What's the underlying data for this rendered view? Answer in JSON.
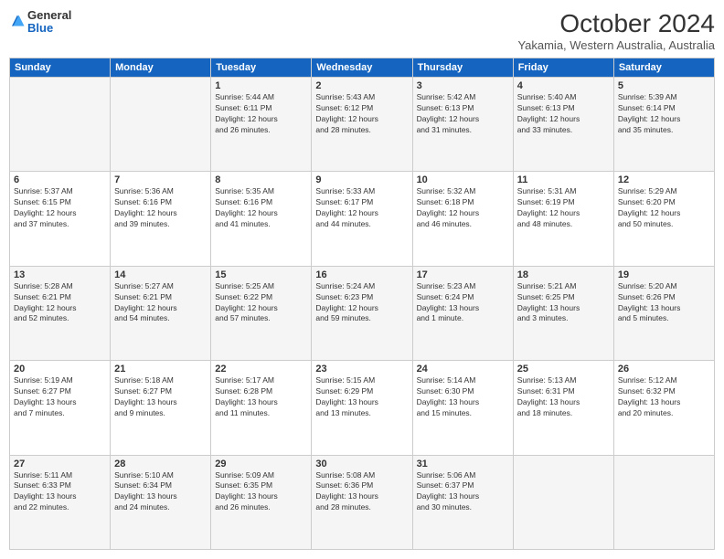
{
  "logo": {
    "general": "General",
    "blue": "Blue"
  },
  "title": "October 2024",
  "location": "Yakamia, Western Australia, Australia",
  "headers": [
    "Sunday",
    "Monday",
    "Tuesday",
    "Wednesday",
    "Thursday",
    "Friday",
    "Saturday"
  ],
  "weeks": [
    [
      {
        "day": "",
        "info": ""
      },
      {
        "day": "",
        "info": ""
      },
      {
        "day": "1",
        "info": "Sunrise: 5:44 AM\nSunset: 6:11 PM\nDaylight: 12 hours\nand 26 minutes."
      },
      {
        "day": "2",
        "info": "Sunrise: 5:43 AM\nSunset: 6:12 PM\nDaylight: 12 hours\nand 28 minutes."
      },
      {
        "day": "3",
        "info": "Sunrise: 5:42 AM\nSunset: 6:13 PM\nDaylight: 12 hours\nand 31 minutes."
      },
      {
        "day": "4",
        "info": "Sunrise: 5:40 AM\nSunset: 6:13 PM\nDaylight: 12 hours\nand 33 minutes."
      },
      {
        "day": "5",
        "info": "Sunrise: 5:39 AM\nSunset: 6:14 PM\nDaylight: 12 hours\nand 35 minutes."
      }
    ],
    [
      {
        "day": "6",
        "info": "Sunrise: 5:37 AM\nSunset: 6:15 PM\nDaylight: 12 hours\nand 37 minutes."
      },
      {
        "day": "7",
        "info": "Sunrise: 5:36 AM\nSunset: 6:16 PM\nDaylight: 12 hours\nand 39 minutes."
      },
      {
        "day": "8",
        "info": "Sunrise: 5:35 AM\nSunset: 6:16 PM\nDaylight: 12 hours\nand 41 minutes."
      },
      {
        "day": "9",
        "info": "Sunrise: 5:33 AM\nSunset: 6:17 PM\nDaylight: 12 hours\nand 44 minutes."
      },
      {
        "day": "10",
        "info": "Sunrise: 5:32 AM\nSunset: 6:18 PM\nDaylight: 12 hours\nand 46 minutes."
      },
      {
        "day": "11",
        "info": "Sunrise: 5:31 AM\nSunset: 6:19 PM\nDaylight: 12 hours\nand 48 minutes."
      },
      {
        "day": "12",
        "info": "Sunrise: 5:29 AM\nSunset: 6:20 PM\nDaylight: 12 hours\nand 50 minutes."
      }
    ],
    [
      {
        "day": "13",
        "info": "Sunrise: 5:28 AM\nSunset: 6:21 PM\nDaylight: 12 hours\nand 52 minutes."
      },
      {
        "day": "14",
        "info": "Sunrise: 5:27 AM\nSunset: 6:21 PM\nDaylight: 12 hours\nand 54 minutes."
      },
      {
        "day": "15",
        "info": "Sunrise: 5:25 AM\nSunset: 6:22 PM\nDaylight: 12 hours\nand 57 minutes."
      },
      {
        "day": "16",
        "info": "Sunrise: 5:24 AM\nSunset: 6:23 PM\nDaylight: 12 hours\nand 59 minutes."
      },
      {
        "day": "17",
        "info": "Sunrise: 5:23 AM\nSunset: 6:24 PM\nDaylight: 13 hours\nand 1 minute."
      },
      {
        "day": "18",
        "info": "Sunrise: 5:21 AM\nSunset: 6:25 PM\nDaylight: 13 hours\nand 3 minutes."
      },
      {
        "day": "19",
        "info": "Sunrise: 5:20 AM\nSunset: 6:26 PM\nDaylight: 13 hours\nand 5 minutes."
      }
    ],
    [
      {
        "day": "20",
        "info": "Sunrise: 5:19 AM\nSunset: 6:27 PM\nDaylight: 13 hours\nand 7 minutes."
      },
      {
        "day": "21",
        "info": "Sunrise: 5:18 AM\nSunset: 6:27 PM\nDaylight: 13 hours\nand 9 minutes."
      },
      {
        "day": "22",
        "info": "Sunrise: 5:17 AM\nSunset: 6:28 PM\nDaylight: 13 hours\nand 11 minutes."
      },
      {
        "day": "23",
        "info": "Sunrise: 5:15 AM\nSunset: 6:29 PM\nDaylight: 13 hours\nand 13 minutes."
      },
      {
        "day": "24",
        "info": "Sunrise: 5:14 AM\nSunset: 6:30 PM\nDaylight: 13 hours\nand 15 minutes."
      },
      {
        "day": "25",
        "info": "Sunrise: 5:13 AM\nSunset: 6:31 PM\nDaylight: 13 hours\nand 18 minutes."
      },
      {
        "day": "26",
        "info": "Sunrise: 5:12 AM\nSunset: 6:32 PM\nDaylight: 13 hours\nand 20 minutes."
      }
    ],
    [
      {
        "day": "27",
        "info": "Sunrise: 5:11 AM\nSunset: 6:33 PM\nDaylight: 13 hours\nand 22 minutes."
      },
      {
        "day": "28",
        "info": "Sunrise: 5:10 AM\nSunset: 6:34 PM\nDaylight: 13 hours\nand 24 minutes."
      },
      {
        "day": "29",
        "info": "Sunrise: 5:09 AM\nSunset: 6:35 PM\nDaylight: 13 hours\nand 26 minutes."
      },
      {
        "day": "30",
        "info": "Sunrise: 5:08 AM\nSunset: 6:36 PM\nDaylight: 13 hours\nand 28 minutes."
      },
      {
        "day": "31",
        "info": "Sunrise: 5:06 AM\nSunset: 6:37 PM\nDaylight: 13 hours\nand 30 minutes."
      },
      {
        "day": "",
        "info": ""
      },
      {
        "day": "",
        "info": ""
      }
    ]
  ]
}
